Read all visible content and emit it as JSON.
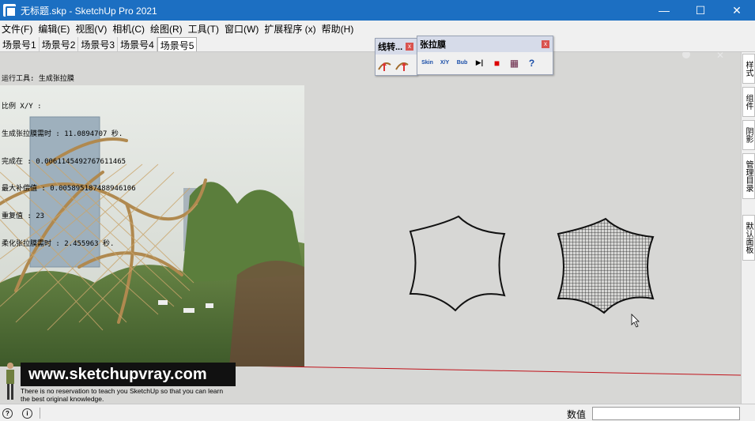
{
  "window": {
    "title": "无标题.skp - SketchUp Pro 2021",
    "minimize_glyph": "—",
    "maximize_glyph": "☐",
    "close_glyph": "✕"
  },
  "menu": [
    "文件(F)",
    "编辑(E)",
    "视图(V)",
    "相机(C)",
    "绘图(R)",
    "工具(T)",
    "窗口(W)",
    "扩展程序 (x)",
    "帮助(H)"
  ],
  "scenes": [
    "场景号1",
    "场景号2",
    "场景号3",
    "场景号4",
    "场景号5"
  ],
  "active_scene": "场景号5",
  "info_lines": [
    "运行工具: 生成张拉膜",
    "比例 X/Y :",
    "生成张拉膜需时 : 11.0894707 秒.",
    "完成在 : 0.0061145492767611465",
    "最大补偿值 : 0.005895187488946106",
    "重复值 : 23",
    "柔化张拉膜需时 : 2.455963 秒."
  ],
  "toolbar_line": {
    "title": "线转...",
    "close": "x"
  },
  "toolbar_membrane": {
    "title": "张拉膜",
    "close": "x",
    "buttons": [
      "Skin",
      "X/Y",
      "Bub",
      "▶|",
      "■",
      "▦",
      "?"
    ]
  },
  "right_tabs": [
    "样式",
    "组件",
    "阴影",
    "管理目录",
    "默认面板"
  ],
  "banner": {
    "url": "www.sketchupvray.com",
    "line1": "There is no reservation to teach you SketchUp so that you can learn",
    "line2": "the best original knowledge."
  },
  "status": {
    "measure_label": "数值"
  },
  "colors": {
    "titlebar": "#1c6fc2",
    "axis_red": "#c0121a"
  }
}
